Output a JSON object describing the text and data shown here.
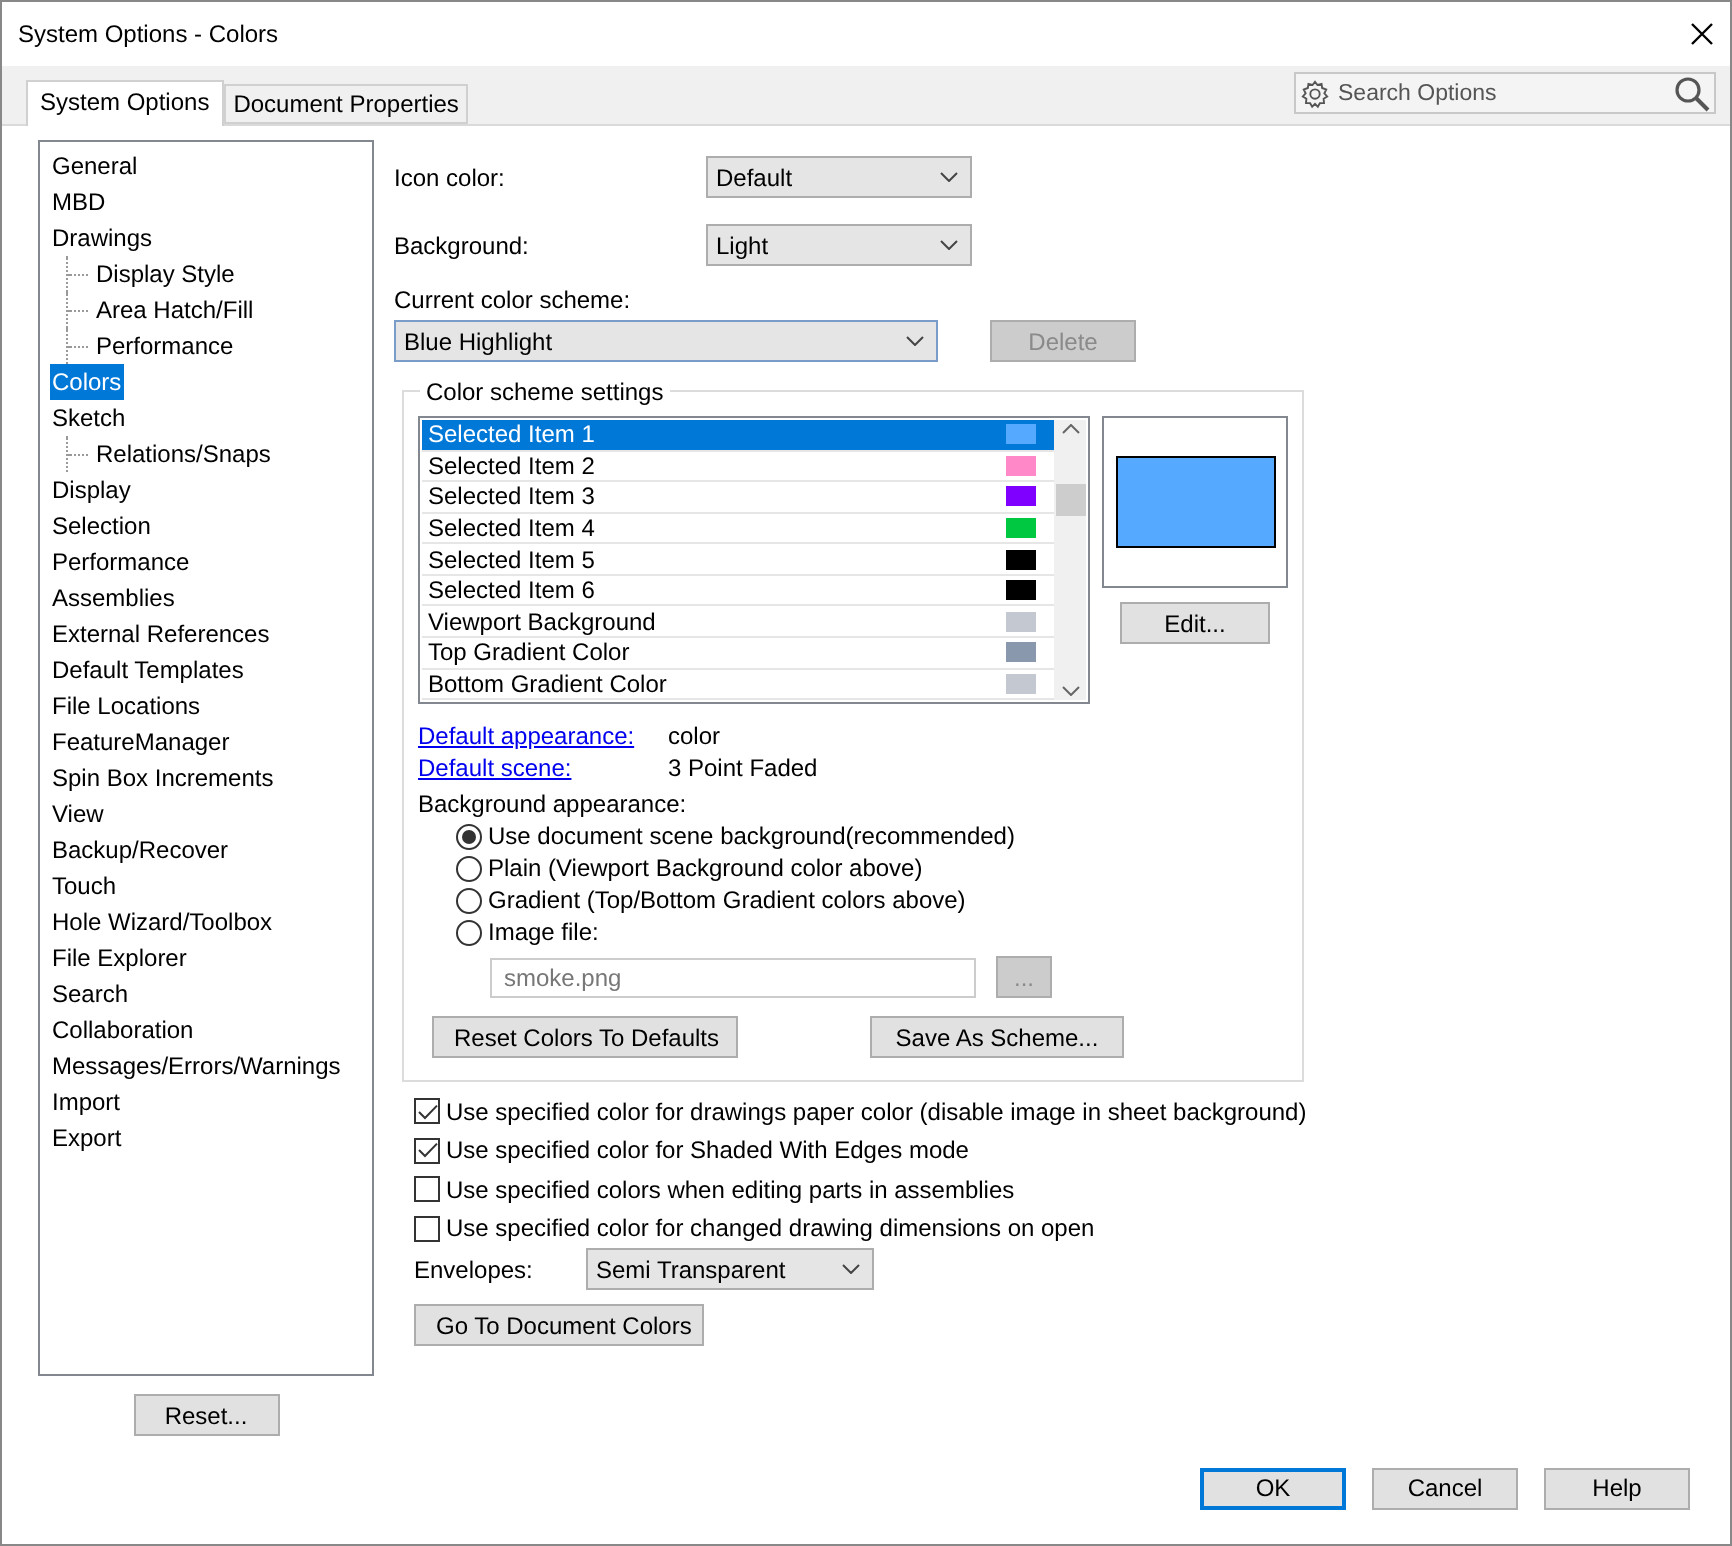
{
  "window": {
    "title": "System Options - Colors"
  },
  "tabs": [
    {
      "label": "System Options",
      "selected": true
    },
    {
      "label": "Document Properties",
      "selected": false
    }
  ],
  "search": {
    "placeholder": "Search Options"
  },
  "tree": [
    {
      "label": "General",
      "selected": false
    },
    {
      "label": "MBD",
      "selected": false
    },
    {
      "label": "Drawings",
      "selected": false,
      "children": [
        {
          "label": "Display Style",
          "selected": false
        },
        {
          "label": "Area Hatch/Fill",
          "selected": false
        },
        {
          "label": "Performance",
          "selected": false
        }
      ]
    },
    {
      "label": "Colors",
      "selected": true
    },
    {
      "label": "Sketch",
      "selected": false,
      "children": [
        {
          "label": "Relations/Snaps",
          "selected": false
        }
      ]
    },
    {
      "label": "Display",
      "selected": false
    },
    {
      "label": "Selection",
      "selected": false
    },
    {
      "label": "Performance",
      "selected": false
    },
    {
      "label": "Assemblies",
      "selected": false
    },
    {
      "label": "External References",
      "selected": false
    },
    {
      "label": "Default Templates",
      "selected": false
    },
    {
      "label": "File Locations",
      "selected": false
    },
    {
      "label": "FeatureManager",
      "selected": false
    },
    {
      "label": "Spin Box Increments",
      "selected": false
    },
    {
      "label": "View",
      "selected": false
    },
    {
      "label": "Backup/Recover",
      "selected": false
    },
    {
      "label": "Touch",
      "selected": false
    },
    {
      "label": "Hole Wizard/Toolbox",
      "selected": false
    },
    {
      "label": "File Explorer",
      "selected": false
    },
    {
      "label": "Search",
      "selected": false
    },
    {
      "label": "Collaboration",
      "selected": false
    },
    {
      "label": "Messages/Errors/Warnings",
      "selected": false
    },
    {
      "label": "Import",
      "selected": false
    },
    {
      "label": "Export",
      "selected": false
    }
  ],
  "reset_button": "Reset...",
  "icon_color": {
    "label": "Icon color:",
    "value": "Default"
  },
  "background": {
    "label": "Background:",
    "value": "Light"
  },
  "scheme": {
    "label": "Current color scheme:",
    "value": "Blue Highlight"
  },
  "delete_button": {
    "label": "Delete",
    "disabled": true
  },
  "color_scheme": {
    "title": "Color scheme settings",
    "items": [
      {
        "label": "Selected Item 1",
        "color": "#55aaff",
        "selected": true
      },
      {
        "label": "Selected Item 2",
        "color": "#ff88c8",
        "selected": false
      },
      {
        "label": "Selected Item 3",
        "color": "#8000ff",
        "selected": false
      },
      {
        "label": "Selected Item 4",
        "color": "#00c840",
        "selected": false
      },
      {
        "label": "Selected Item 5",
        "color": "#000000",
        "selected": false
      },
      {
        "label": "Selected Item 6",
        "color": "#000000",
        "selected": false
      },
      {
        "label": "Viewport Background",
        "color": "#c4c8d0",
        "selected": false
      },
      {
        "label": "Top Gradient Color",
        "color": "#8a98ad",
        "selected": false
      },
      {
        "label": "Bottom Gradient Color",
        "color": "#c4c8d0",
        "selected": false
      }
    ],
    "edit_button": "Edit...",
    "default_appearance": {
      "label": "Default appearance:",
      "value": "color"
    },
    "default_scene": {
      "label": "Default scene:",
      "value": "3 Point Faded"
    },
    "background_appearance": {
      "label": "Background appearance:",
      "options": [
        {
          "label": "Use document scene background(recommended)",
          "selected": true
        },
        {
          "label": "Plain (Viewport Background color above)",
          "selected": false
        },
        {
          "label": "Gradient (Top/Bottom Gradient colors above)",
          "selected": false
        },
        {
          "label": "Image file:",
          "selected": false
        }
      ]
    },
    "image_file": {
      "value": "smoke.png",
      "disabled": true
    },
    "browse_button": {
      "label": "...",
      "disabled": true
    },
    "reset_colors_button": "Reset Colors To Defaults",
    "save_scheme_button": "Save As Scheme..."
  },
  "options": [
    {
      "label": "Use specified color for drawings paper color (disable image in sheet background)",
      "checked": true
    },
    {
      "label": "Use specified color for Shaded With Edges mode",
      "checked": true
    },
    {
      "label": "Use specified colors when editing parts in assemblies",
      "checked": false
    },
    {
      "label": "Use specified color for changed drawing dimensions on open",
      "checked": false
    }
  ],
  "envelopes": {
    "label": "Envelopes:",
    "value": "Semi Transparent"
  },
  "document_colors_button": "Go To Document Colors",
  "footer_buttons": [
    {
      "label": "OK",
      "default": true
    },
    {
      "label": "Cancel",
      "default": false
    },
    {
      "label": "Help",
      "default": false
    }
  ]
}
